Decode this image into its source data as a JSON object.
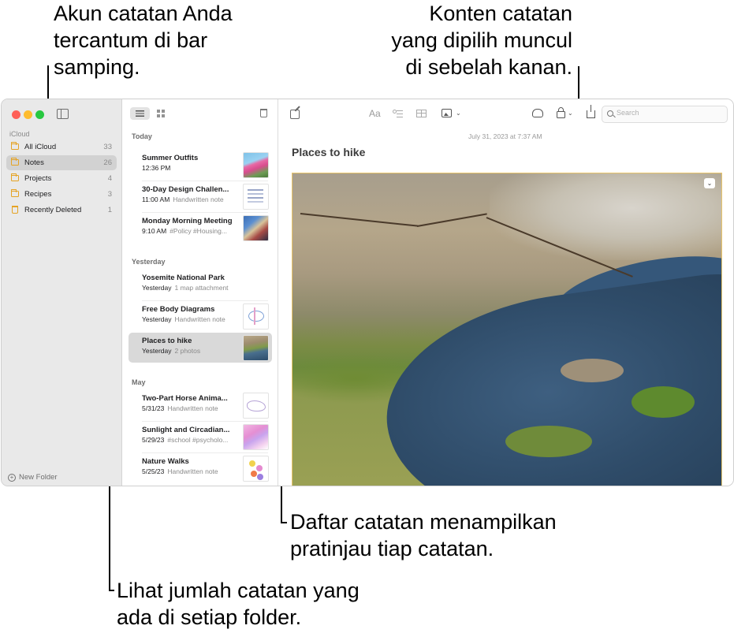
{
  "annotations": {
    "sidebar_callout": [
      "Akun catatan Anda",
      "tercantum di bar",
      "samping."
    ],
    "content_callout": [
      "Konten catatan",
      "yang dipilih muncul",
      "di sebelah kanan."
    ],
    "list_callout": [
      "Daftar catatan menampilkan",
      "pratinjau tiap catatan."
    ],
    "count_callout": [
      "Lihat jumlah catatan yang",
      "ada di setiap folder."
    ]
  },
  "sidebar": {
    "account": "iCloud",
    "folders": [
      {
        "name": "All iCloud",
        "count": "33",
        "icon": "folder-icon"
      },
      {
        "name": "Notes",
        "count": "26",
        "icon": "folder-icon",
        "selected": true
      },
      {
        "name": "Projects",
        "count": "4",
        "icon": "folder-icon"
      },
      {
        "name": "Recipes",
        "count": "3",
        "icon": "folder-icon"
      },
      {
        "name": "Recently Deleted",
        "count": "1",
        "icon": "trash-icon"
      }
    ],
    "new_folder": "New Folder"
  },
  "note_list": {
    "sections": [
      {
        "label": "Today",
        "notes": [
          {
            "title": "Summer Outfits",
            "date": "12:36 PM",
            "preview": ""
          },
          {
            "title": "30-Day Design Challen...",
            "date": "11:00 AM",
            "preview": "Handwritten note"
          },
          {
            "title": "Monday Morning Meeting",
            "date": "9:10 AM",
            "preview": "#Policy #Housing..."
          }
        ]
      },
      {
        "label": "Yesterday",
        "notes": [
          {
            "title": "Yosemite National Park",
            "date": "Yesterday",
            "preview": "1 map attachment"
          },
          {
            "title": "Free Body Diagrams",
            "date": "Yesterday",
            "preview": "Handwritten note"
          },
          {
            "title": "Places to hike",
            "date": "Yesterday",
            "preview": "2 photos",
            "selected": true
          }
        ]
      },
      {
        "label": "May",
        "notes": [
          {
            "title": "Two-Part Horse Anima...",
            "date": "5/31/23",
            "preview": "Handwritten note"
          },
          {
            "title": "Sunlight and Circadian...",
            "date": "5/29/23",
            "preview": "#school #psycholo..."
          },
          {
            "title": "Nature Walks",
            "date": "5/25/23",
            "preview": "Handwritten note"
          }
        ]
      }
    ]
  },
  "content": {
    "date": "July 31, 2023 at 7:37 AM",
    "title": "Places to hike",
    "font_button": "Aa",
    "search_placeholder": "Search"
  },
  "colors": {
    "accent_folder": "#e5a324",
    "selection_gray": "#d9d9d9",
    "traffic_red": "#fe5f57",
    "traffic_yellow": "#febc2e",
    "traffic_green": "#28c840"
  }
}
